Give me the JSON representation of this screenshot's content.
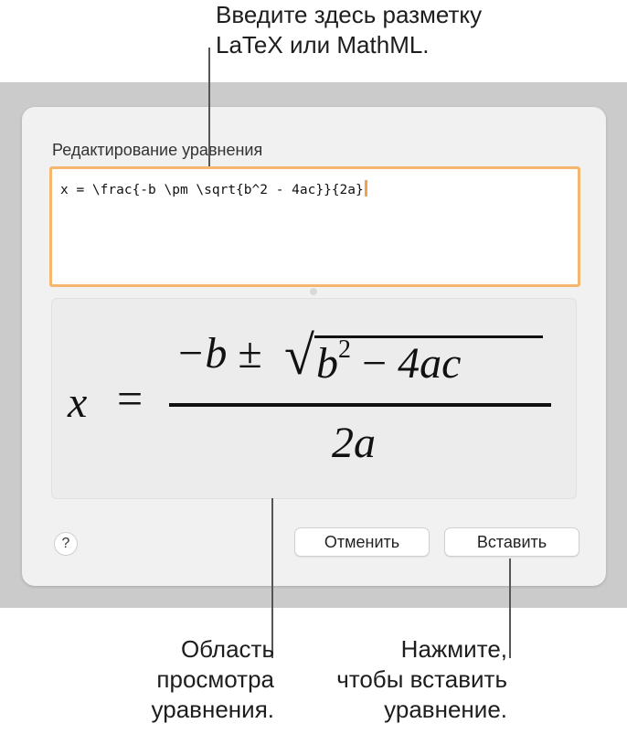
{
  "callouts": {
    "top_line1": "Введите здесь разметку",
    "top_line2": "LaTeX или MathML.",
    "preview_line1": "Область",
    "preview_line2": "просмотра",
    "preview_line3": "уравнения.",
    "insert_line1": "Нажмите,",
    "insert_line2": "чтобы вставить",
    "insert_line3": "уравнение."
  },
  "dialog": {
    "title": "Редактирование уравнения",
    "editor_value": "x = \\frac{-b \\pm \\sqrt{b^2 - 4ac}}{2a}",
    "preview": {
      "lhs": "x",
      "equals": "=",
      "numerator_pre": "−b ",
      "pm": "±",
      "radicand_b": "b",
      "exponent": "2",
      "minus": " − ",
      "radicand_rest": "4ac",
      "denominator": "2a"
    },
    "help_label": "?",
    "cancel_label": "Отменить",
    "insert_label": "Вставить"
  },
  "colors": {
    "editor_focus_border": "#f5b66e",
    "caret": "#f0a34a",
    "backdrop": "#cbcbcb",
    "dialog_bg": "#f1f1f1"
  }
}
